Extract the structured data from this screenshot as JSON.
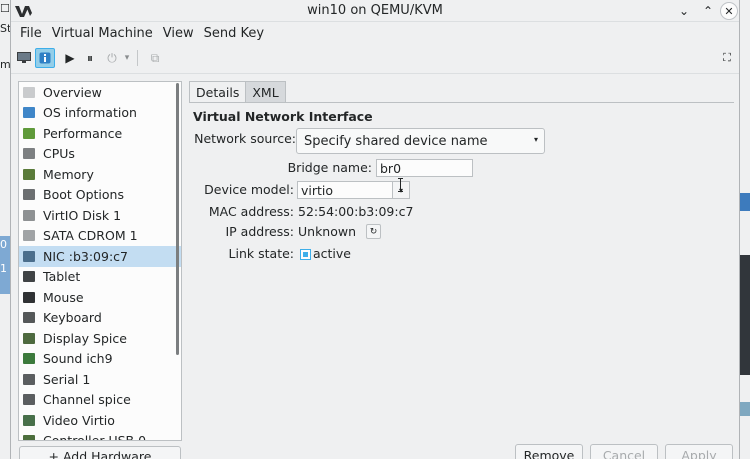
{
  "window": {
    "title": "win10 on QEMU/KVM",
    "minimize_glyph": "⌄",
    "maximize_glyph": "⌃",
    "close_glyph": "✕"
  },
  "background": {
    "fragments": [
      "☐",
      "St",
      "ma",
      "0",
      "1"
    ]
  },
  "menubar": {
    "items": [
      "File",
      "Virtual Machine",
      "View",
      "Send Key"
    ]
  },
  "toolbar": {
    "console_icon": "monitor-icon",
    "details_icon": "info-icon",
    "run_glyph": "▶",
    "pause_glyph": "⏸",
    "power_glyph": "⏻",
    "dropdown_glyph": "▾",
    "clone_glyph": "⧉",
    "fullscreen_glyph": "⛶"
  },
  "device_list": {
    "selected_index": 8,
    "items": [
      {
        "label": "Overview",
        "icon": "overview-icon",
        "color": "#c9cbcd"
      },
      {
        "label": "OS information",
        "icon": "os-info-icon",
        "color": "#3f86c8"
      },
      {
        "label": "Performance",
        "icon": "performance-icon",
        "color": "#5f9a3a"
      },
      {
        "label": "CPUs",
        "icon": "cpu-icon",
        "color": "#7d8082"
      },
      {
        "label": "Memory",
        "icon": "memory-icon",
        "color": "#5a7b3a"
      },
      {
        "label": "Boot Options",
        "icon": "boot-options-icon",
        "color": "#6c6f71"
      },
      {
        "label": "VirtIO Disk 1",
        "icon": "disk-icon",
        "color": "#8e9193"
      },
      {
        "label": "SATA CDROM 1",
        "icon": "cdrom-icon",
        "color": "#a0a3a5"
      },
      {
        "label": "NIC :b3:09:c7",
        "icon": "nic-icon",
        "color": "#4b6e8c"
      },
      {
        "label": "Tablet",
        "icon": "tablet-icon",
        "color": "#404345"
      },
      {
        "label": "Mouse",
        "icon": "mouse-icon",
        "color": "#303234"
      },
      {
        "label": "Keyboard",
        "icon": "keyboard-icon",
        "color": "#555859"
      },
      {
        "label": "Display Spice",
        "icon": "display-icon",
        "color": "#4e6a3f"
      },
      {
        "label": "Sound ich9",
        "icon": "sound-icon",
        "color": "#3c7a3c"
      },
      {
        "label": "Serial 1",
        "icon": "serial-icon",
        "color": "#5b5e60"
      },
      {
        "label": "Channel spice",
        "icon": "channel-icon",
        "color": "#5b5e60"
      },
      {
        "label": "Video Virtio",
        "icon": "video-icon",
        "color": "#48704a"
      },
      {
        "label": "Controller USB 0",
        "icon": "controller-icon",
        "color": "#4c6e3c"
      }
    ],
    "add_hardware_label": "+ Add Hardware"
  },
  "tabs": {
    "details": "Details",
    "xml": "XML"
  },
  "nic": {
    "section_title": "Virtual Network Interface",
    "network_source_label": "Network source:",
    "network_source_value": "Specify shared device name",
    "network_source_arrow": "▾",
    "bridge_name_label": "Bridge name:",
    "bridge_name_value": "br0",
    "device_model_label": "Device model:",
    "device_model_value": "virtio",
    "device_model_arrow": "▾",
    "mac_label": "MAC address:",
    "mac_value": "52:54:00:b3:09:c7",
    "ip_label": "IP address:",
    "ip_value": "Unknown",
    "refresh_glyph": "↻",
    "link_label": "Link state:",
    "link_value": "active"
  },
  "buttons": {
    "remove": "Remove",
    "cancel": "Cancel",
    "apply": "Apply"
  }
}
